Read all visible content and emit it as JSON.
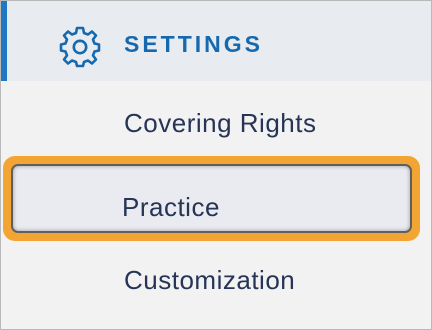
{
  "header": {
    "title": "SETTINGS",
    "icon": "gear-icon",
    "accent_color": "#1f78c2"
  },
  "menu": {
    "items": [
      {
        "label": "Covering Rights",
        "active": false
      },
      {
        "label": "Practice",
        "active": true
      },
      {
        "label": "Customization",
        "active": false
      }
    ]
  },
  "colors": {
    "highlight": "#f3a533",
    "text": "#263456",
    "title": "#1769ae"
  }
}
